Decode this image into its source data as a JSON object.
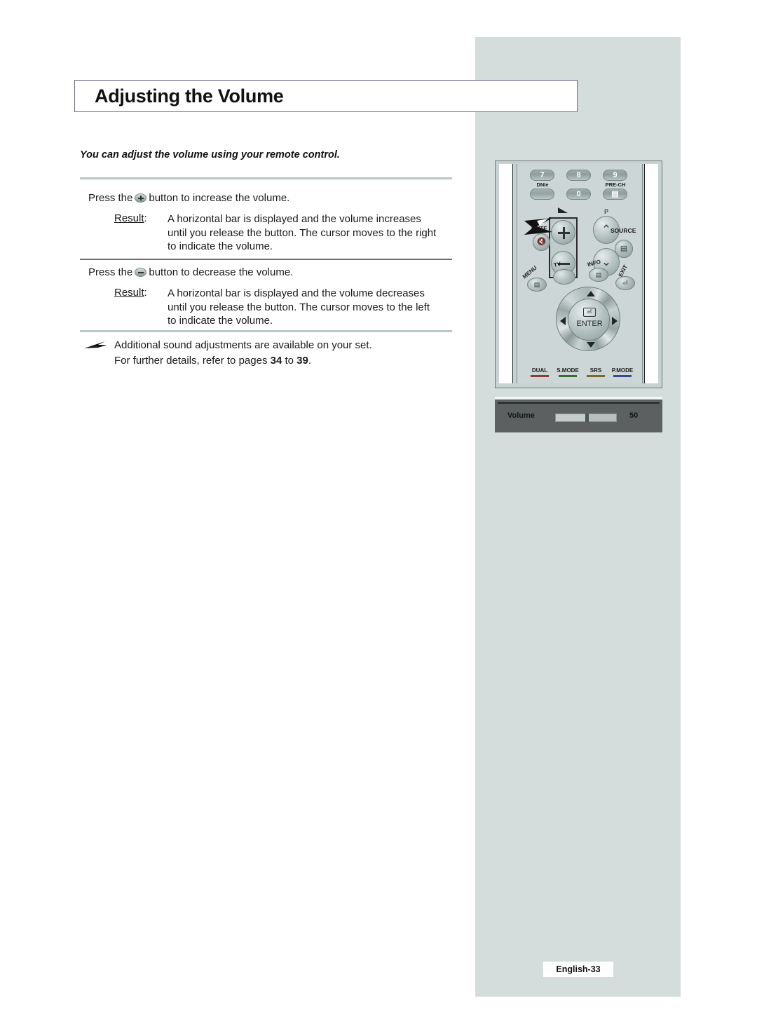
{
  "page": {
    "title": "Adjusting the Volume",
    "subtitle": "You can adjust the volume using your remote control.",
    "footer": "English-33",
    "accent_border": "#6b6b8c",
    "panel_color": "#d4dcdc",
    "rule_light": "#b9c6c8",
    "rule_dark": "#6f6f6f"
  },
  "sections": [
    {
      "press_prefix": "Press the",
      "button_icon": "plus-button-icon",
      "press_suffix": "button to increase the volume.",
      "result_label": "Result",
      "result_colon": ":",
      "result_lines": [
        "A horizontal bar is displayed and the volume increases",
        "until you release the button. The cursor moves to the right",
        "to indicate the volume."
      ]
    },
    {
      "press_prefix": "Press the",
      "button_icon": "minus-button-icon",
      "press_suffix": "button to decrease the volume.",
      "result_label": "Result",
      "result_colon": ":",
      "result_lines": [
        "A horizontal bar is displayed and the volume decreases",
        "until you release the button. The cursor moves to the left",
        "to indicate the volume."
      ]
    }
  ],
  "note": {
    "line1": "Additional sound adjustments are available on your set.",
    "line2_a": "For further details, refer to pages ",
    "line2_page_from": "34",
    "line2_mid": " to ",
    "line2_page_to": "39",
    "line2_end": "."
  },
  "remote": {
    "numbers": [
      {
        "label": "7"
      },
      {
        "label": "8"
      },
      {
        "label": "9"
      }
    ],
    "zero": "0",
    "dnie_label": "DNIe",
    "prech_label": "PRE-CH",
    "p_label": "P",
    "mute_label": "MUTE",
    "source_label": "SOURCE",
    "menu_label": "MENU",
    "tv_label": "TV",
    "info_label": "INFO",
    "exit_label": "EXIT",
    "enter_label": "ENTER",
    "bottom_labels": [
      {
        "label": "DUAL",
        "color": "#8d3a3a"
      },
      {
        "label": "S.MODE",
        "color": "#3a6a3a"
      },
      {
        "label": "SRS",
        "color": "#7a6a2a"
      },
      {
        "label": "P.MODE",
        "color": "#3a4a8d"
      }
    ]
  },
  "osd": {
    "label": "Volume",
    "value": "50",
    "progress_percent": 50,
    "background": "#5d6060"
  }
}
